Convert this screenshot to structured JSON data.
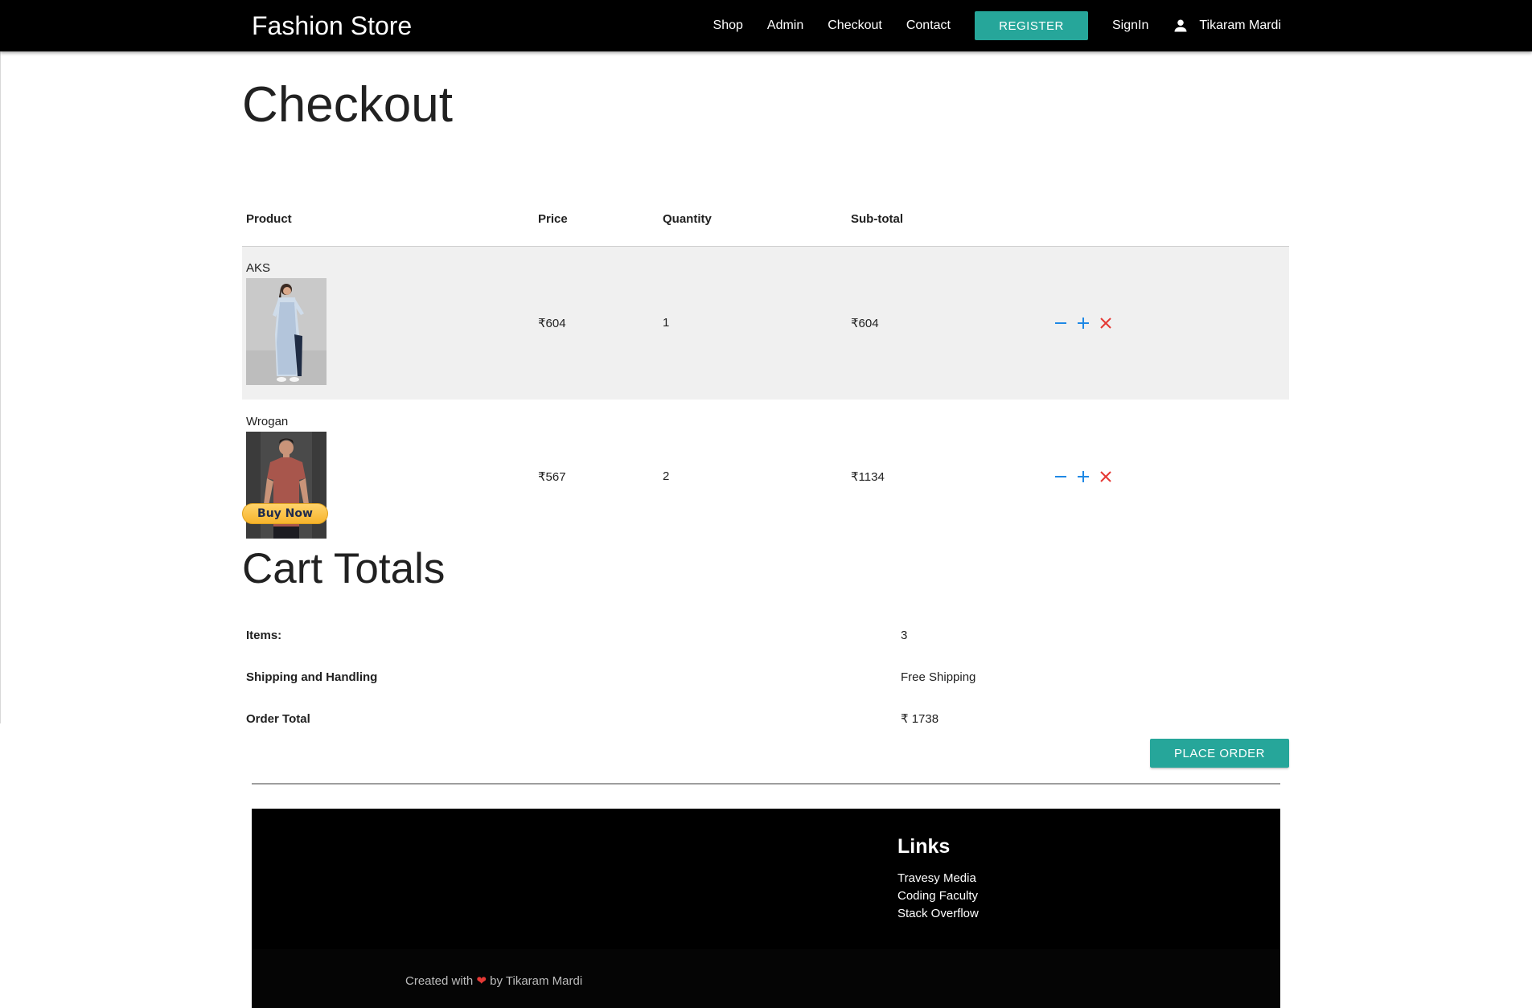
{
  "nav": {
    "brand": "Fashion Store",
    "links": [
      "Shop",
      "Admin",
      "Checkout",
      "Contact"
    ],
    "register": "REGISTER",
    "signin": "SignIn",
    "user": "Tikaram Mardi"
  },
  "checkout": {
    "title": "Checkout",
    "headers": [
      "Product",
      "Price",
      "Quantity",
      "Sub-total"
    ],
    "items": [
      {
        "name": "AKS",
        "price": "₹604",
        "quantity": "1",
        "subtotal": "₹604"
      },
      {
        "name": "Wrogan",
        "price": "₹567",
        "quantity": "2",
        "subtotal": "₹1134"
      }
    ],
    "buy_now": "Buy Now"
  },
  "totals": {
    "title": "Cart Totals",
    "rows": [
      {
        "label": "Items:",
        "value": "3"
      },
      {
        "label": "Shipping and Handling",
        "value": "Free Shipping"
      },
      {
        "label": "Order Total",
        "value": "₹ 1738"
      }
    ],
    "place_order": "PLACE ORDER"
  },
  "footer": {
    "links_title": "Links",
    "links": [
      "Travesy Media",
      "Coding Faculty",
      "Stack Overflow"
    ],
    "copy_prefix": "Created with",
    "copy_heart": "❤",
    "copy_suffix": "by Tikaram Mardi"
  },
  "colors": {
    "nav_bg": "#000000",
    "accent": "#26a69a",
    "minus_plus": "#1e88e5",
    "remove": "#e53935",
    "paypal_yellow": "#ffc439"
  },
  "icons": [
    "person-icon",
    "minus-icon",
    "plus-icon",
    "close-icon",
    "heart-icon"
  ]
}
